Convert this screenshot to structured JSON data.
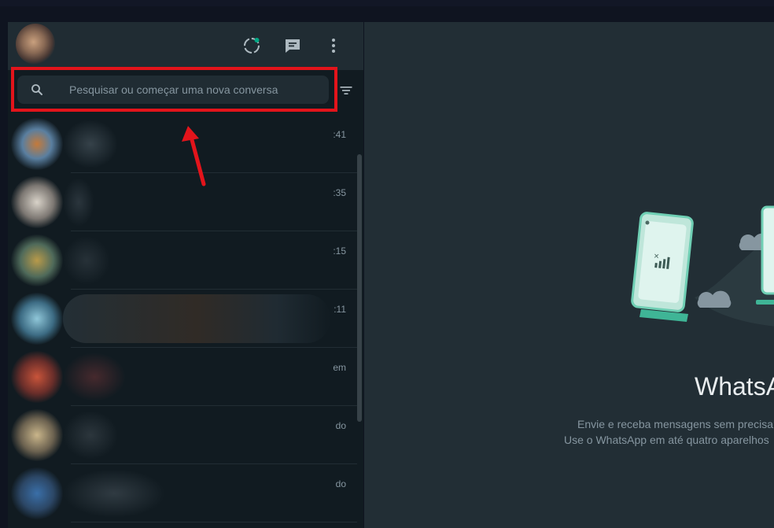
{
  "sidebar": {
    "header": {
      "avatar_alt": "",
      "icons": [
        "status-icon",
        "new-chat-icon",
        "menu-icon"
      ]
    },
    "search": {
      "placeholder": "Pesquisar ou começar uma nova conversa",
      "value": ""
    },
    "chats": [
      {
        "time": ":41",
        "avatar_color": "#c47a3a"
      },
      {
        "time": ":35",
        "avatar_color": "#d8d2c8"
      },
      {
        "time": ":15",
        "avatar_color": "#b89a4a"
      },
      {
        "time": ":11",
        "avatar_color": "#8fc6d8"
      },
      {
        "time": "em",
        "avatar_color": "#c8543a"
      },
      {
        "time": "do",
        "avatar_color": "#c9b58a"
      },
      {
        "time": "do",
        "avatar_color": "#3a6fa8"
      }
    ]
  },
  "main": {
    "title": "WhatsAp",
    "line1": "Envie e receba mensagens sem precisar",
    "line2": "Use o WhatsApp em até quatro aparelhos"
  },
  "colors": {
    "accent": "#00a884",
    "highlight": "#e3141b",
    "sidebar_bg": "#111b21",
    "panel_bg": "#222e35"
  }
}
